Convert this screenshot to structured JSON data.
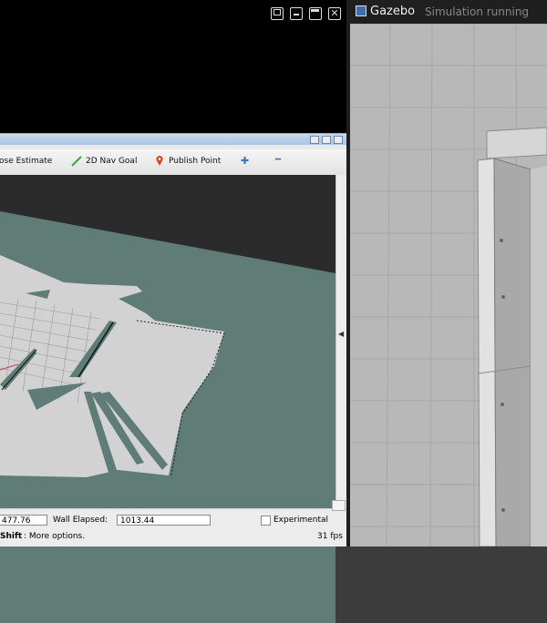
{
  "terminal": {
    "controls": {
      "restore": "restore-window",
      "minimize": "minimize-window",
      "maximize": "maximize-window",
      "close": "✕"
    }
  },
  "rviz": {
    "toolbar": {
      "pose_estimate": "ose Estimate",
      "nav_goal": "2D Nav Goal",
      "publish_point": "Publish Point",
      "add_icon": "✚",
      "remove_icon": "━"
    },
    "time": {
      "ros_elapsed_value": "477.76",
      "wall_elapsed_label": "Wall Elapsed:",
      "wall_elapsed_value": "1013.44",
      "experimental_label": "Experimental"
    },
    "status": {
      "hint_key": "Shift",
      "hint_text": ": More options.",
      "fps": "31 fps"
    },
    "colors": {
      "map_ground": "#5f7c76",
      "map_free": "#d4d4d4",
      "void": "#2b2b2b"
    }
  },
  "gazebo": {
    "title": "Gazebo",
    "status": "Simulation running"
  }
}
